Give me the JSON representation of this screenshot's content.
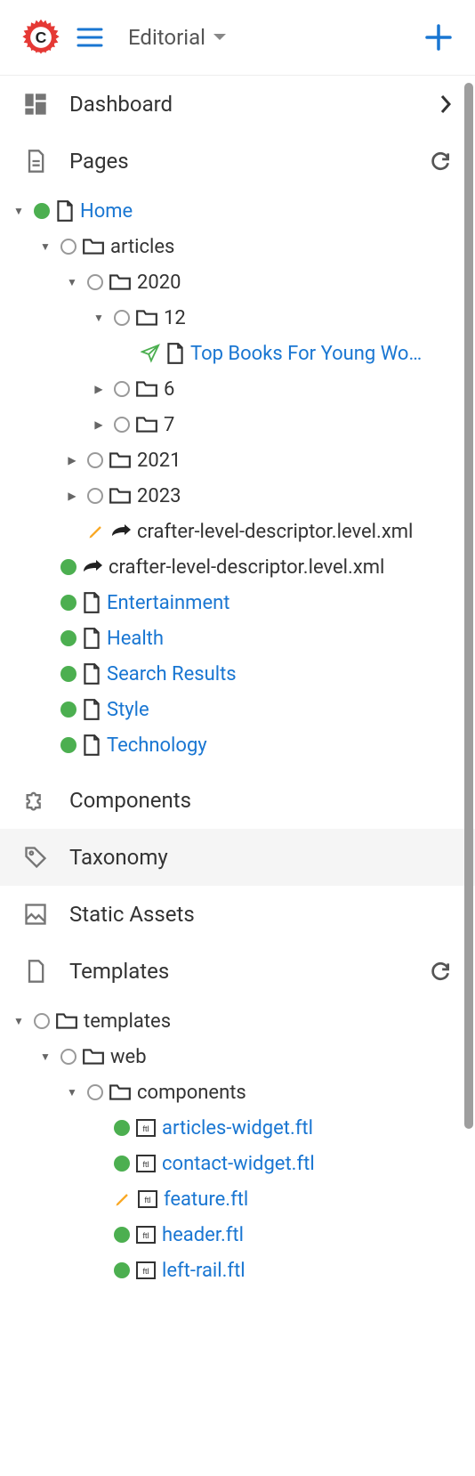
{
  "topbar": {
    "site_name": "Editorial"
  },
  "nav": {
    "dashboard": "Dashboard",
    "pages": "Pages",
    "components": "Components",
    "taxonomy": "Taxonomy",
    "static_assets": "Static Assets",
    "templates": "Templates"
  },
  "pages_tree": {
    "home": "Home",
    "articles": "articles",
    "y2020": "2020",
    "m12": "12",
    "top_books": "Top Books For Young Wo…",
    "m6": "6",
    "m7": "7",
    "y2021": "2021",
    "y2023": "2023",
    "crafter_desc_1": "crafter-level-descriptor.level.xml",
    "crafter_desc_2": "crafter-level-descriptor.level.xml",
    "entertainment": "Entertainment",
    "health": "Health",
    "search_results": "Search Results",
    "style": "Style",
    "technology": "Technology"
  },
  "templates_tree": {
    "templates": "templates",
    "web": "web",
    "components": "components",
    "articles_widget": "articles-widget.ftl",
    "contact_widget": "contact-widget.ftl",
    "feature": "feature.ftl",
    "header": "header.ftl",
    "left_rail": "left-rail.ftl"
  }
}
